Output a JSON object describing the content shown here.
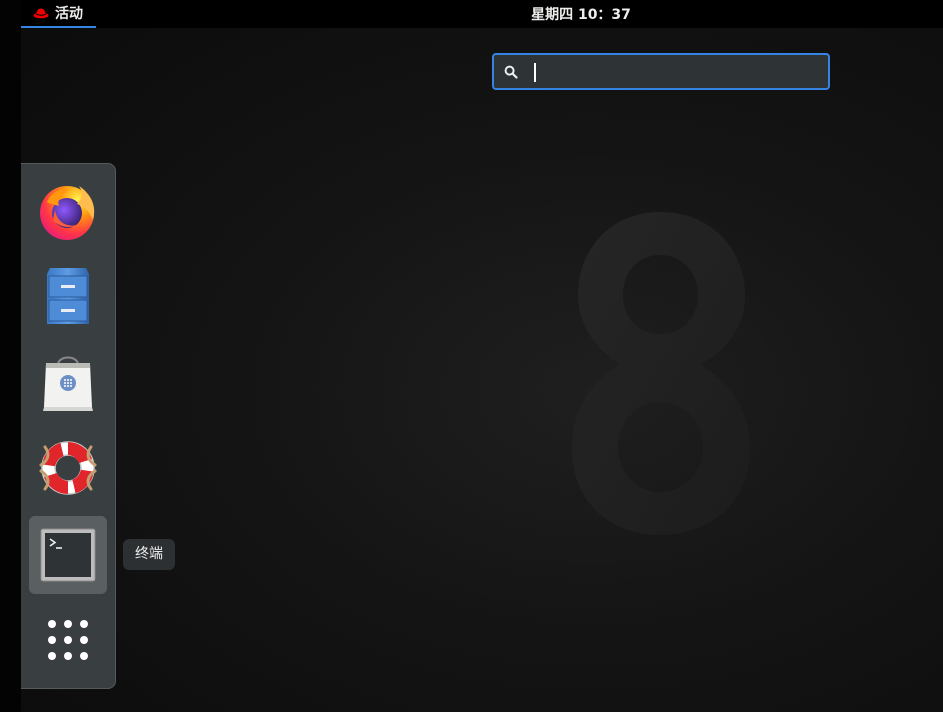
{
  "top_bar": {
    "activities_label": "活动",
    "clock": "星期四 10：37"
  },
  "search": {
    "value": "",
    "placeholder": ""
  },
  "dash": {
    "apps": [
      {
        "name": "firefox",
        "icon": "firefox-icon"
      },
      {
        "name": "files",
        "icon": "file-cabinet-icon"
      },
      {
        "name": "software",
        "icon": "shopping-bag-icon"
      },
      {
        "name": "help",
        "icon": "lifebuoy-icon"
      },
      {
        "name": "terminal",
        "icon": "terminal-icon",
        "hovered": true
      },
      {
        "name": "show-applications",
        "icon": "app-grid-icon"
      }
    ],
    "tooltip": "终端"
  },
  "colors": {
    "accent": "#3584e4",
    "dash_bg": "#393e40",
    "top_bar_bg": "#000000",
    "redhat_red": "#ee0000"
  }
}
